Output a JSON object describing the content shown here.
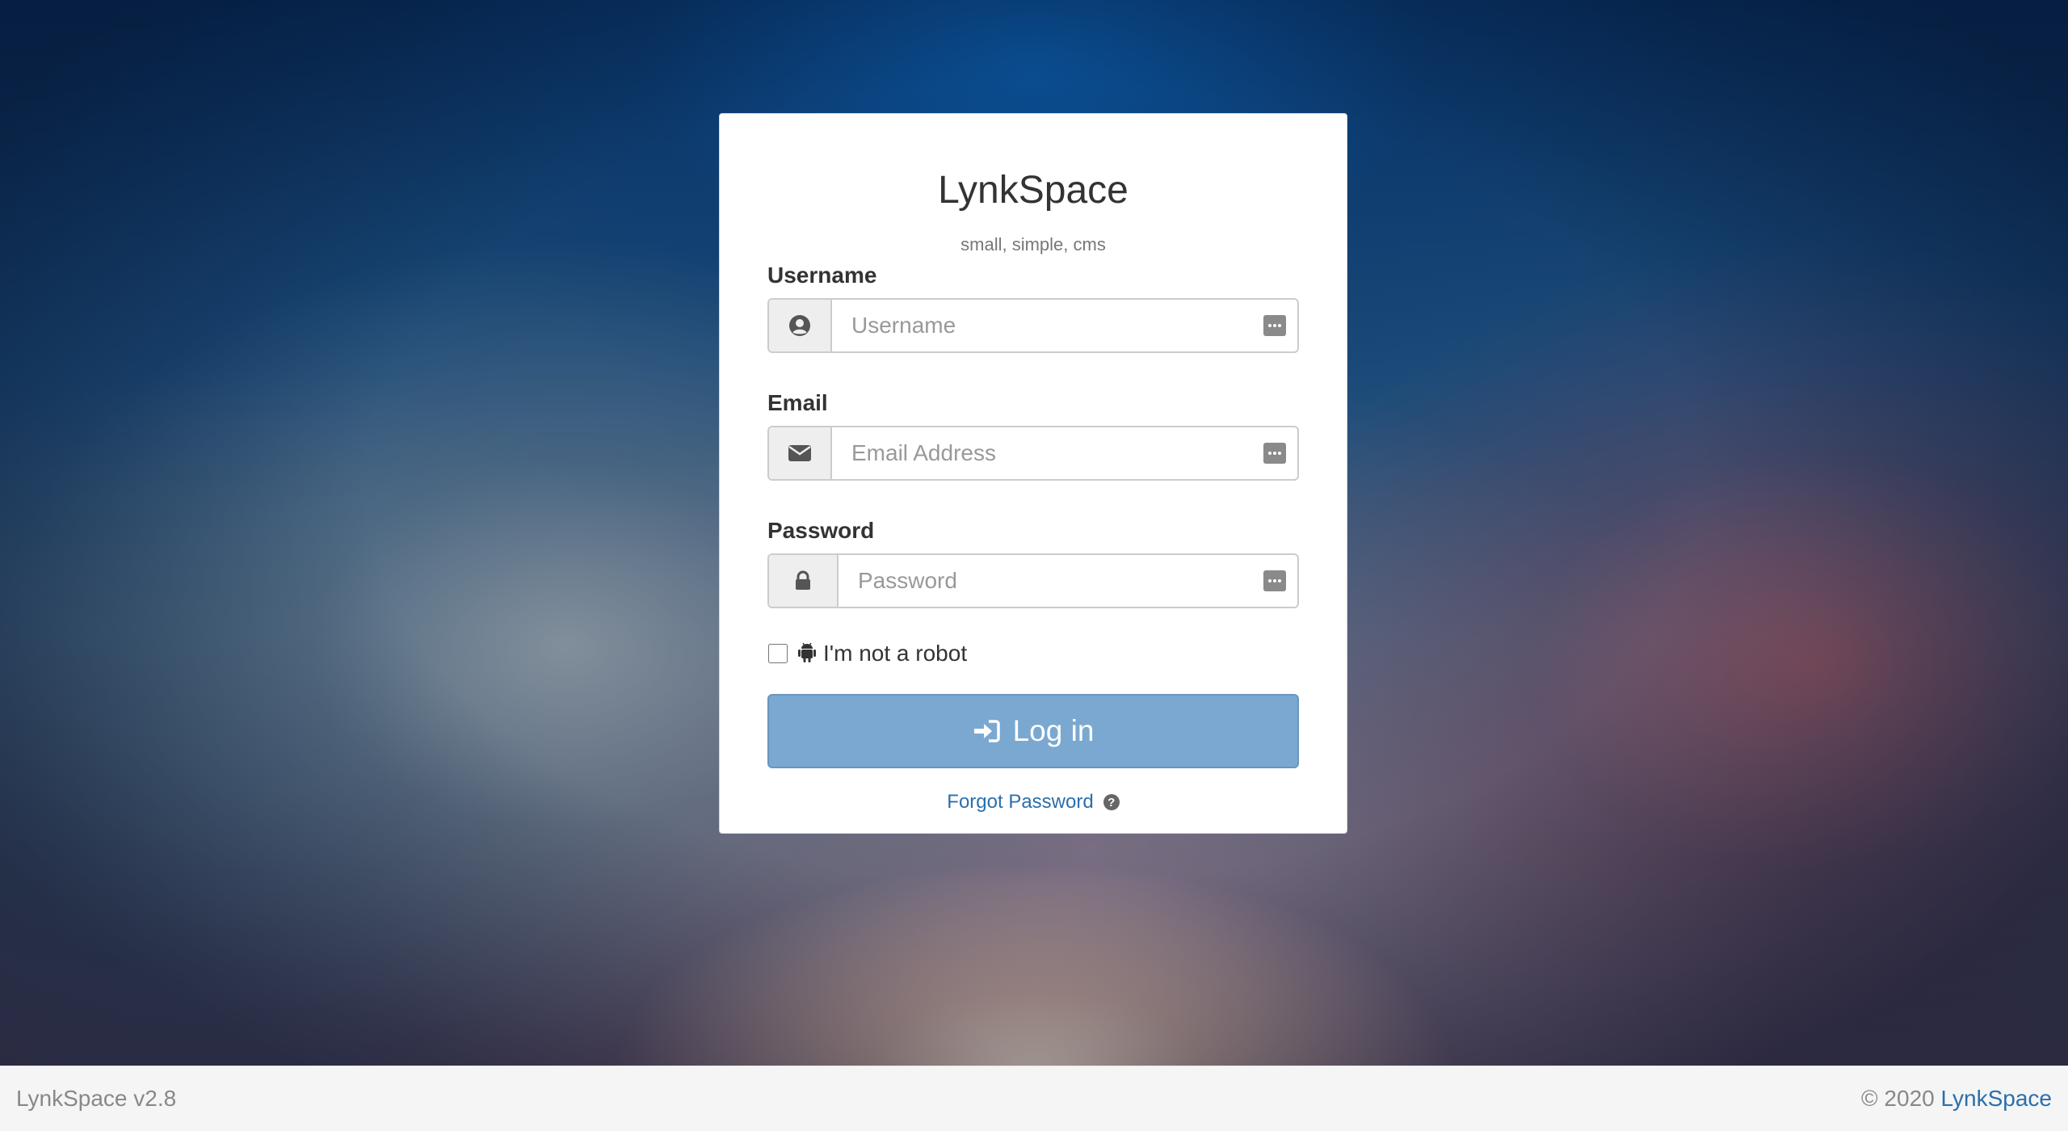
{
  "app": {
    "title": "LynkSpace",
    "subtitle": "small, simple, cms"
  },
  "form": {
    "username_label": "Username",
    "username_placeholder": "Username",
    "email_label": "Email",
    "email_placeholder": "Email Address",
    "password_label": "Password",
    "password_placeholder": "Password",
    "robot_label": "I'm not a robot",
    "robot_checked": false,
    "login_label": "Log in",
    "forgot_label": "Forgot Password"
  },
  "icons": {
    "username": "user-circle-icon",
    "email": "envelope-icon",
    "password": "lock-icon",
    "robot": "android-icon",
    "login": "sign-in-icon",
    "help": "question-circle-icon",
    "password_manager": "password-manager-icon"
  },
  "footer": {
    "version": "LynkSpace v2.8",
    "copyright": "© 2020",
    "brand_link": "LynkSpace"
  },
  "colors": {
    "login_button": "#7aa8d0",
    "link": "#2a6fad"
  }
}
